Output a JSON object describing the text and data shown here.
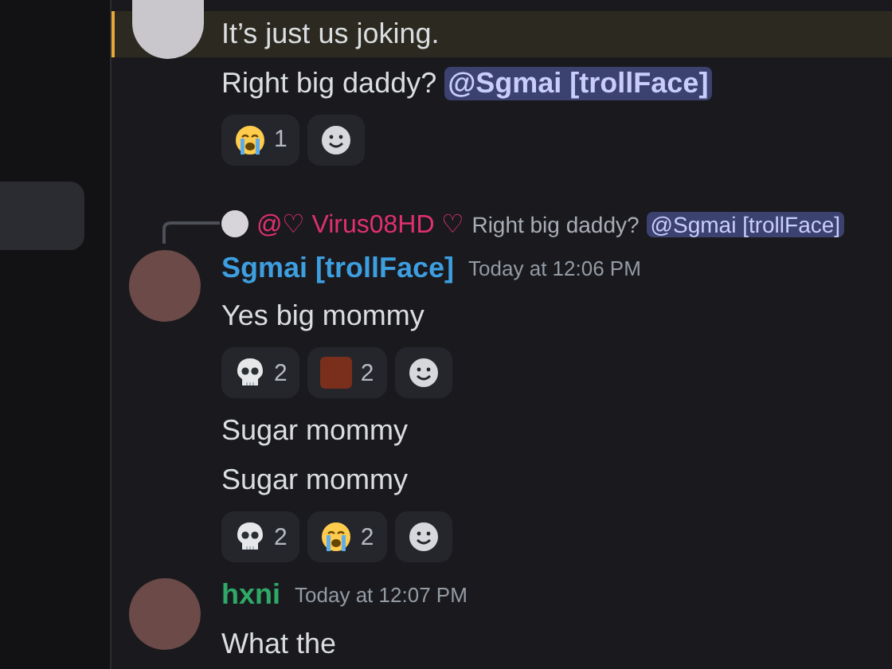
{
  "sidebar": {
    "items": [
      {
        "selected": true
      }
    ]
  },
  "messages": [
    {
      "kind": "text",
      "highlighted": true,
      "avatar": true,
      "text": "It’s just us joking."
    },
    {
      "kind": "text",
      "highlighted": false,
      "text": "Right big daddy?",
      "mention": "@Sgmai [trollFace]"
    },
    {
      "kind": "reactions",
      "reactions": [
        {
          "kind": "crying",
          "count": "1"
        },
        {
          "kind": "add"
        }
      ]
    },
    {
      "kind": "reply",
      "author": "@♡ Virus08HD ♡",
      "color": "#e0306e",
      "text": "Right big daddy?",
      "mention": "@Sgmai [trollFace]"
    },
    {
      "kind": "header",
      "author": "Sgmai [trollFace]",
      "color": "#3d9ee0",
      "time": "Today at 12:06 PM"
    },
    {
      "kind": "text",
      "highlighted": false,
      "text": "Yes big mommy"
    },
    {
      "kind": "reactions",
      "reactions": [
        {
          "kind": "skull",
          "count": "2"
        },
        {
          "kind": "sticker",
          "count": "2"
        },
        {
          "kind": "add"
        }
      ]
    },
    {
      "kind": "text",
      "highlighted": false,
      "text": "Sugar mommy"
    },
    {
      "kind": "text",
      "highlighted": false,
      "text": "Sugar mommy"
    },
    {
      "kind": "reactions",
      "reactions": [
        {
          "kind": "skull",
          "count": "2"
        },
        {
          "kind": "crying",
          "count": "2"
        },
        {
          "kind": "add"
        }
      ]
    },
    {
      "kind": "header",
      "author": "hxni",
      "color": "#2fa968",
      "time": "Today at 12:07 PM"
    },
    {
      "kind": "text",
      "highlighted": false,
      "text": "What the"
    }
  ]
}
